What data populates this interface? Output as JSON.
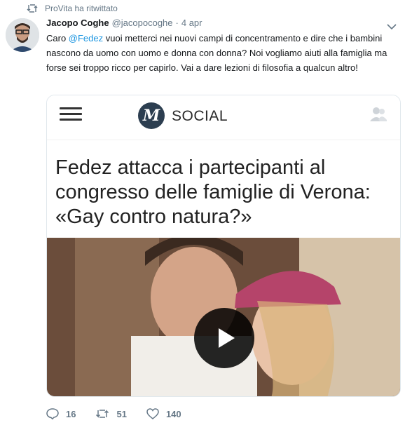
{
  "retweet": {
    "text": "ProVita ha ritwittato",
    "icon": "retweet-icon"
  },
  "author": {
    "name": "Jacopo Coghe",
    "handle": "@jacopocoghe",
    "dot": "·",
    "date": "4 apr"
  },
  "tweet": {
    "prefix": "Caro ",
    "mention": "@Fedez",
    "body": " vuoi metterci nei nuovi campi di concentramento e dire che i bambini nascono da uomo con uomo e donna con donna? Noi vogliamo aiuti alla famiglia ma forse sei troppo ricco per capirlo. Vai a dare lezioni di filosofia a qualcun altro!"
  },
  "card": {
    "logo_letter": "M",
    "section": "SOCIAL",
    "title": "Fedez attacca i partecipanti al congresso delle famiglie di Verona: «Gay contro natura?»"
  },
  "actions": {
    "replies": "16",
    "retweets": "51",
    "likes": "140"
  },
  "colors": {
    "link": "#1b95e0",
    "muted": "#657786",
    "text": "#14171a"
  }
}
